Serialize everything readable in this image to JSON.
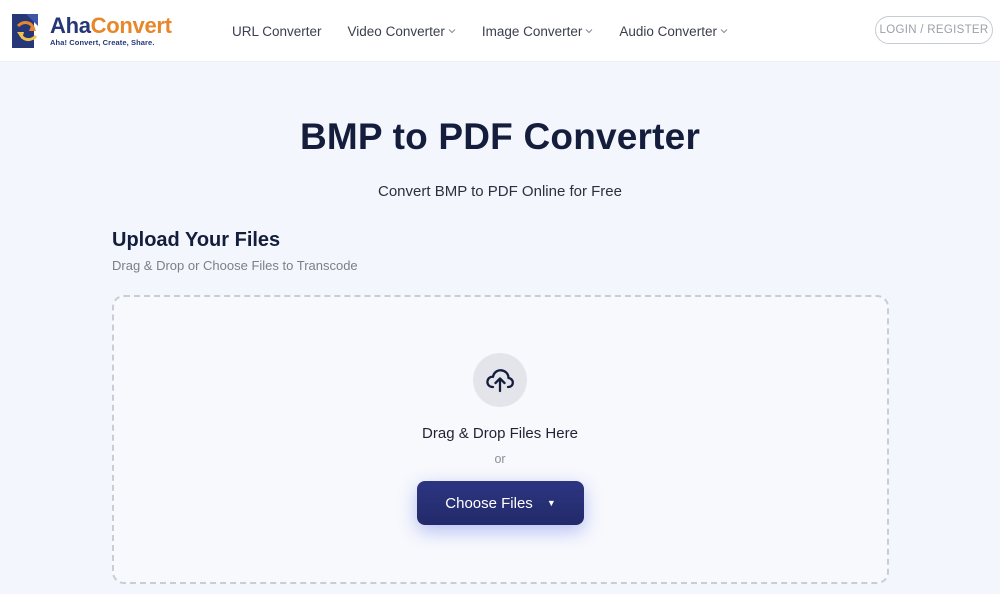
{
  "header": {
    "logo": {
      "name_part1": "Aha",
      "name_part2": "Convert",
      "tagline": "Aha! Convert, Create, Share."
    },
    "nav": [
      {
        "label": "URL Converter",
        "has_dropdown": false
      },
      {
        "label": "Video Converter",
        "has_dropdown": true
      },
      {
        "label": "Image Converter",
        "has_dropdown": true
      },
      {
        "label": "Audio Converter",
        "has_dropdown": true
      }
    ],
    "login_label": "LOGIN / REGISTER"
  },
  "hero": {
    "title": "BMP to PDF Converter",
    "subtitle": "Convert BMP to PDF Online for Free"
  },
  "upload": {
    "heading": "Upload Your Files",
    "subheading": "Drag & Drop or Choose Files to Transcode",
    "drop_text": "Drag & Drop Files Here",
    "or_text": "or",
    "choose_label": "Choose Files",
    "icon": "cloud-upload-icon"
  },
  "colors": {
    "brand_navy": "#263777",
    "brand_orange": "#e8862a",
    "button_bg": "#2c3581",
    "page_bg": "#f3f6fc"
  }
}
